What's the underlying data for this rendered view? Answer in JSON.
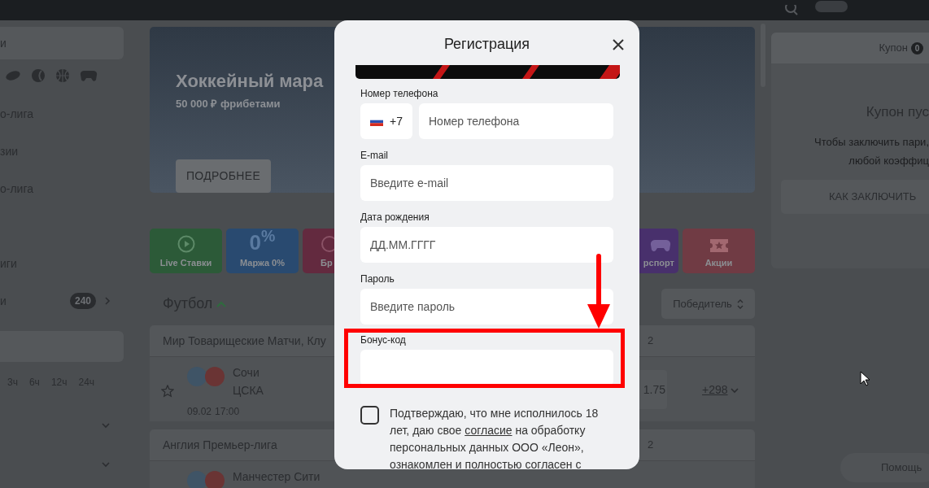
{
  "sidebar": {
    "search_text": "и",
    "items": [
      {
        "label": "о-лига"
      },
      {
        "label": "зии"
      },
      {
        "label": "о-лига"
      },
      {
        "label": "иги"
      },
      {
        "label": "и",
        "count": "240"
      }
    ],
    "time_filters": [
      "3ч",
      "6ч",
      "12ч",
      "24ч"
    ]
  },
  "banner": {
    "title": "Хоккейный мара",
    "subtitle": "50 000 ₽ фрибетами",
    "button": "ПОДРОБНЕЕ"
  },
  "tiles_left": [
    {
      "kind": "live",
      "label": "Live Ставки",
      "color": "#2c5a38"
    },
    {
      "kind": "margin",
      "label": "Маржа 0%",
      "big": "0$^{%}$",
      "color": "#294a70"
    },
    {
      "kind": "partial",
      "label": "Бр",
      "color": "#632a3f"
    }
  ],
  "tiles_right": [
    {
      "kind": "esport",
      "label": "рспорт",
      "color": "#48306c"
    },
    {
      "kind": "promo",
      "label": "Акции",
      "color": "#703b44"
    }
  ],
  "football": {
    "title": "Футбол",
    "market": "Победитель",
    "leagues": [
      {
        "name": "Мир Товарищеские Матчи, Клу",
        "column": "2",
        "matches": [
          {
            "home": "Сочи",
            "away": "ЦСКА",
            "date": "09.02",
            "time": "17:00",
            "odd": "1.75",
            "more": "+298",
            "favorite": false
          }
        ]
      },
      {
        "name": "Англия Премьер-лига",
        "column": "2",
        "matches": [
          {
            "home": "Манчестер Сити"
          }
        ]
      }
    ]
  },
  "coupon": {
    "tab": "Купон",
    "count": "0",
    "title": "Купон пус",
    "lines": [
      "Чтобы заключить пари,",
      "любой коэффиц"
    ],
    "button": "КАК ЗАКЛЮЧИТЬ"
  },
  "help": "Помощь",
  "modal": {
    "title": "Регистрация",
    "phone": {
      "label": "Номер телефона",
      "code": "+7",
      "placeholder": "Номер телефона"
    },
    "fields": [
      {
        "label": "E-mail",
        "placeholder": "Введите e-mail"
      },
      {
        "label": "Дата рождения",
        "placeholder": "ДД.ММ.ГГГГ"
      },
      {
        "label": "Пароль",
        "placeholder": "Введите пароль"
      }
    ],
    "bonus": {
      "label": "Бонус-код",
      "highlighted": true
    },
    "consent": {
      "checked": false,
      "before": "Подтверждаю, что мне исполнилось 18 лет, даю свое",
      "link": "согласие",
      "after": "на обработку персональных данных ООО «Леон», ознакомлен и полностью согласен с"
    }
  }
}
